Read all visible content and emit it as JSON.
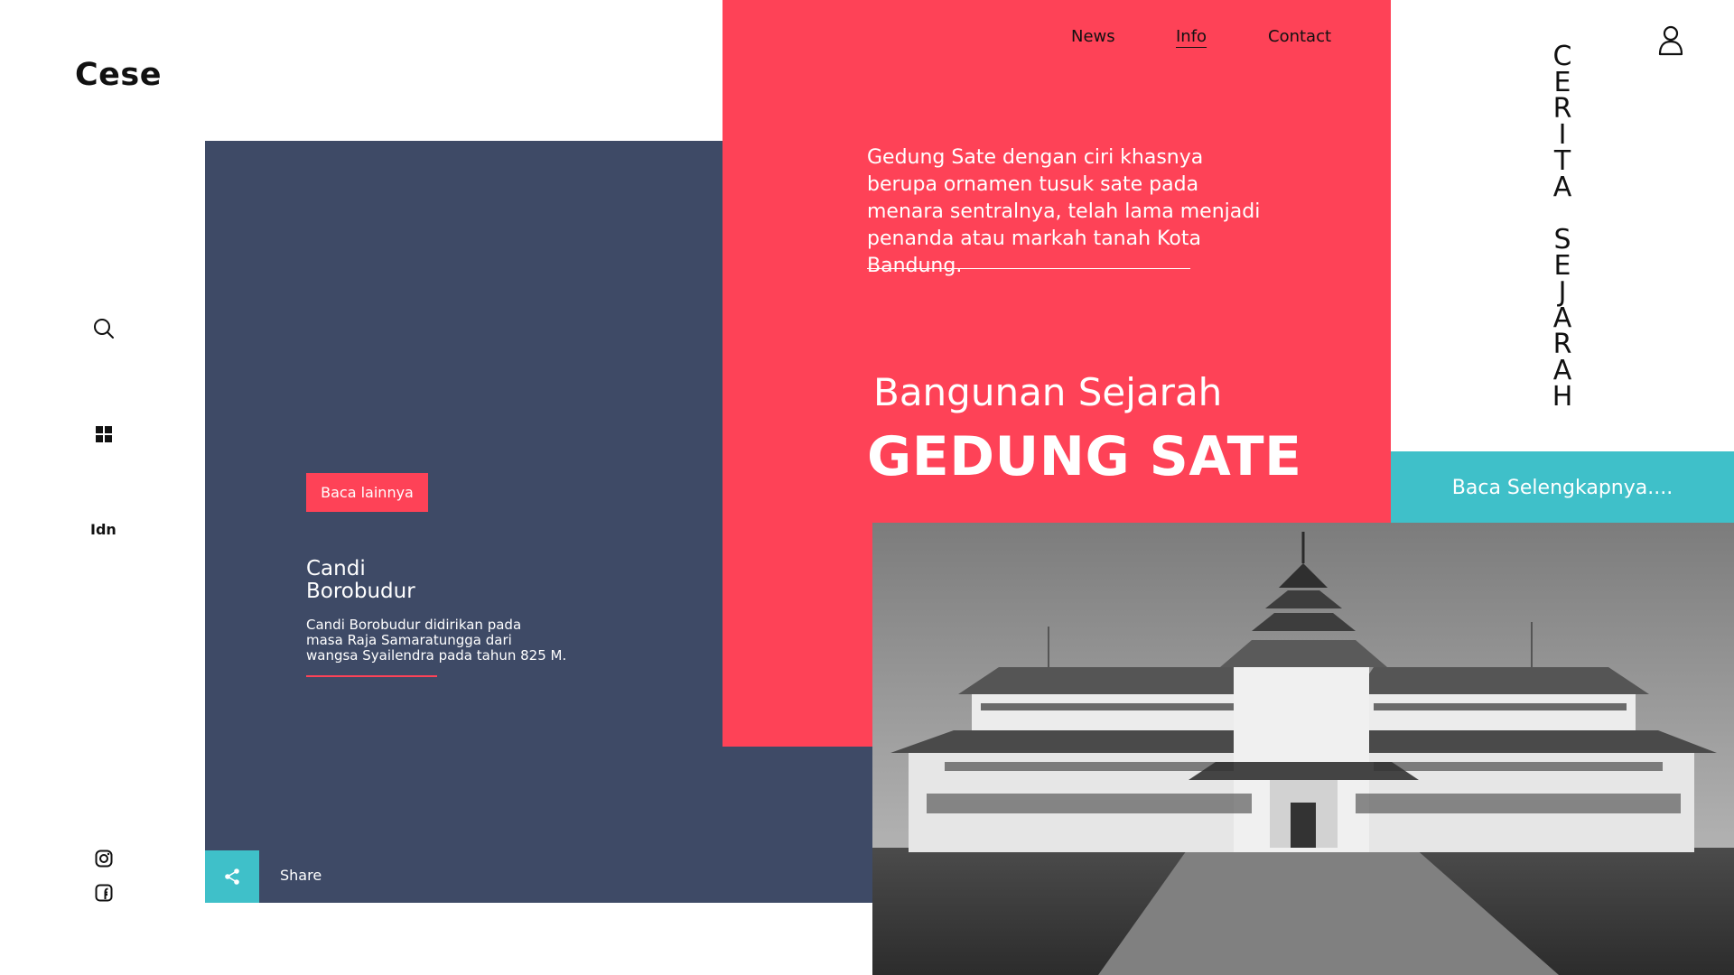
{
  "brand": {
    "logo": "Cese"
  },
  "left_rail": {
    "icons": [
      "search-icon",
      "grid-icon"
    ],
    "language": "Idn",
    "social": [
      "instagram-icon",
      "facebook-icon"
    ]
  },
  "nav": {
    "items": [
      {
        "label": "News",
        "active": false
      },
      {
        "label": "Info",
        "active": true
      },
      {
        "label": "Contact",
        "active": false
      }
    ]
  },
  "feature": {
    "intro": "Gedung Sate dengan ciri khasnya berupa ornamen tusuk sate pada menara sentralnya, telah lama menjadi penanda atau markah tanah Kota Bandung.",
    "subtitle": "Bangunan Sejarah",
    "title": "GEDUNG SATE",
    "read_more": "Baca Selengkapnya...."
  },
  "side_card": {
    "button": "Baca lainnya",
    "title_line1": "Candi",
    "title_line2": "Borobudur",
    "desc_line1": "Candi Borobudur didirikan pada",
    "desc_line2": "masa Raja Samaratungga dari",
    "desc_line3": "wangsa Syailendra pada tahun 825 M."
  },
  "share": {
    "label": "Share",
    "icon": "share-icon"
  },
  "vertical_text": {
    "letters": [
      "C",
      "E",
      "R",
      "I",
      "T",
      "A",
      " ",
      "S",
      "E",
      "J",
      "A",
      "R",
      "A",
      "H"
    ]
  },
  "colors": {
    "red": "#fe4257",
    "navy": "#3e4a66",
    "teal": "#3fc0c9",
    "text": "#111111",
    "white": "#ffffff"
  }
}
